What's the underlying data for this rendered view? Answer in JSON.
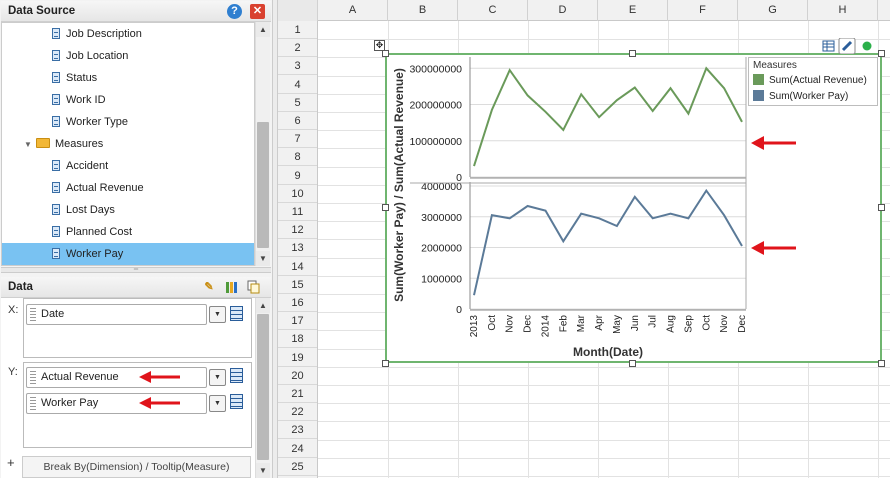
{
  "data_source": {
    "title": "Data Source",
    "fields_top": [
      "Job Description",
      "Job Location",
      "Status",
      "Work ID",
      "Worker Type"
    ],
    "measures_folder": "Measures",
    "measures": [
      "Accident",
      "Actual Revenue",
      "Lost Days",
      "Planned Cost",
      "Worker Pay"
    ],
    "selected": "Worker Pay"
  },
  "data_panel": {
    "title": "Data",
    "x_label": "X:",
    "y_label": "Y:",
    "x_field": "Date",
    "y_fields": [
      "Actual Revenue",
      "Worker Pay"
    ],
    "break_by": "Break By(Dimension) / Tooltip(Measure)",
    "add_symbol": "+"
  },
  "sheet": {
    "columns": [
      "A",
      "B",
      "C",
      "D",
      "E",
      "F",
      "G",
      "H"
    ],
    "rows": [
      "1",
      "2",
      "3",
      "4",
      "5",
      "6",
      "7",
      "8",
      "9",
      "10",
      "11",
      "12",
      "13",
      "14",
      "15",
      "16",
      "17",
      "18",
      "19",
      "20",
      "21",
      "22",
      "23",
      "24",
      "25"
    ]
  },
  "colors": {
    "revenue": "#6a9a5a",
    "worker_pay": "#5b7a98",
    "selection": "#79c2f2",
    "chart_border": "#6fb56f",
    "arrow": "#e0141b"
  },
  "chart_data": {
    "type": "line",
    "x": [
      "2013",
      "Oct",
      "Nov",
      "Dec",
      "2014",
      "Feb",
      "Mar",
      "Apr",
      "May",
      "Jun",
      "Jul",
      "Aug",
      "Sep",
      "Oct",
      "Nov",
      "Dec"
    ],
    "xlabel": "Month(Date)",
    "ylabel": "Sum(Worker Pay) / Sum(Actual Revenue)",
    "legend_title": "Measures",
    "legend_position": "top-right",
    "series": [
      {
        "name": "Sum(Actual Revenue)",
        "values": [
          30000000,
          185000000,
          295000000,
          225000000,
          180000000,
          130000000,
          228000000,
          165000000,
          212000000,
          247000000,
          182000000,
          245000000,
          175000000,
          300000000,
          245000000,
          152000000
        ],
        "ylim": [
          0,
          320000000
        ],
        "ticks": [
          "300000000",
          "200000000",
          "100000000",
          "0"
        ]
      },
      {
        "name": "Sum(Worker Pay)",
        "values": [
          450000,
          3050000,
          2950000,
          3350000,
          3200000,
          2200000,
          3100000,
          2950000,
          2700000,
          3650000,
          2950000,
          3100000,
          2950000,
          3850000,
          3050000,
          2050000
        ],
        "ylim": [
          0,
          4000000
        ],
        "ticks": [
          "4000000",
          "3000000",
          "2000000",
          "1000000",
          "0"
        ]
      }
    ]
  }
}
